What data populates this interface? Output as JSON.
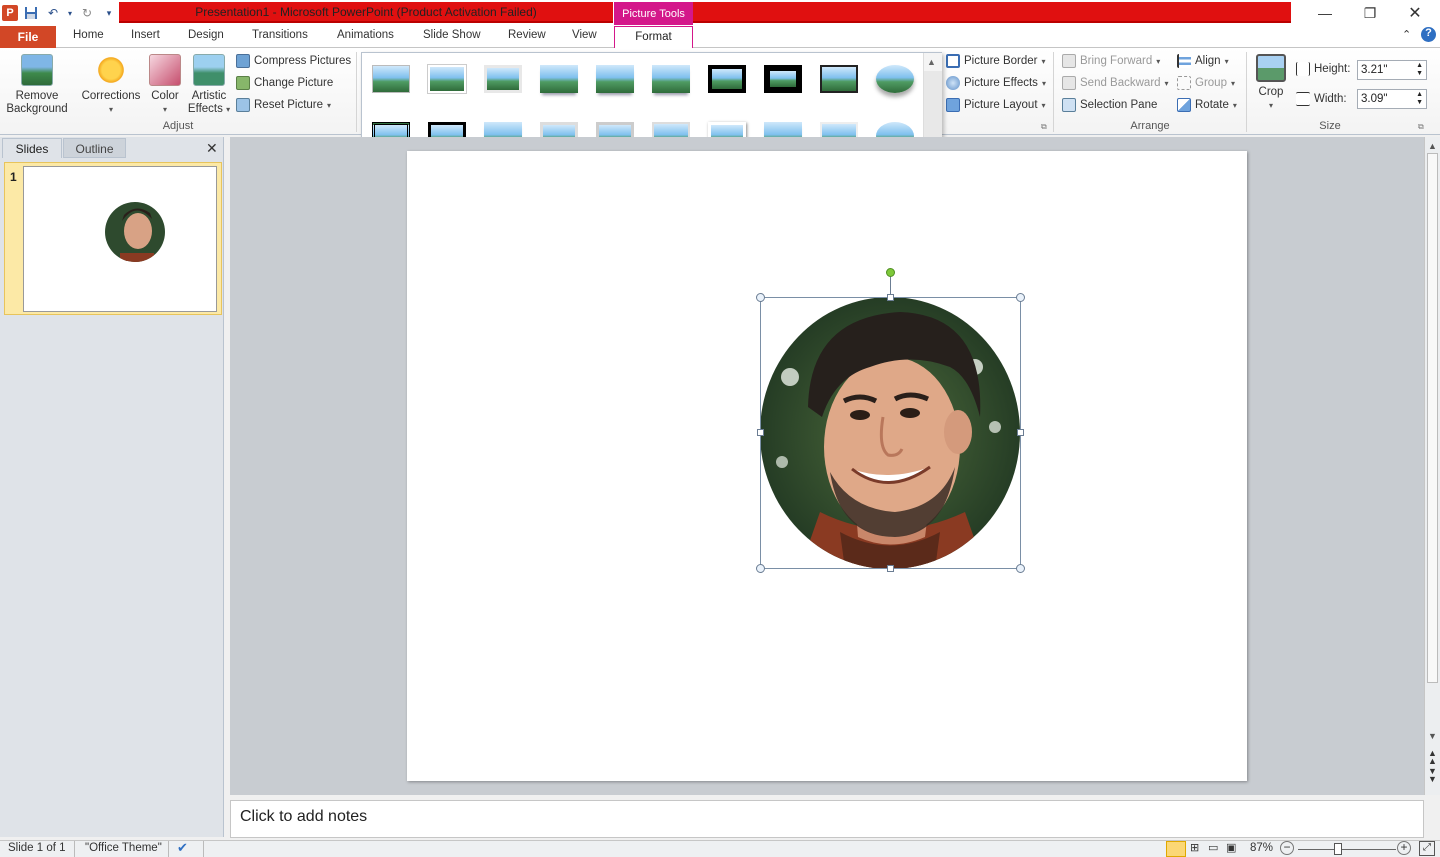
{
  "window": {
    "title": "Presentation1  -  Microsoft PowerPoint (Product Activation Failed)",
    "context_tab_group": "Picture Tools",
    "controls": [
      "minimize",
      "restore",
      "close"
    ]
  },
  "tabs": {
    "file": "File",
    "items": [
      "Home",
      "Insert",
      "Design",
      "Transitions",
      "Animations",
      "Slide Show",
      "Review",
      "View"
    ],
    "active": "Format"
  },
  "ribbon": {
    "adjust": {
      "remove_background": [
        "Remove",
        "Background"
      ],
      "corrections": "Corrections",
      "color": "Color",
      "artistic_effects": [
        "Artistic",
        "Effects"
      ],
      "compress": "Compress Pictures",
      "change": "Change Picture",
      "reset": "Reset Picture",
      "label": "Adjust"
    },
    "picture_styles": {
      "border": "Picture Border",
      "effects": "Picture Effects",
      "layout": "Picture Layout"
    },
    "arrange": {
      "bring_forward": "Bring Forward",
      "send_backward": "Send Backward",
      "selection_pane": "Selection Pane",
      "align": "Align",
      "group": "Group",
      "rotate": "Rotate",
      "label": "Arrange"
    },
    "size": {
      "crop": "Crop",
      "height_label": "Height:",
      "height_value": "3.21\"",
      "width_label": "Width:",
      "width_value": "3.09\"",
      "label": "Size"
    }
  },
  "gallery": {
    "style_count": 28
  },
  "slides_pane": {
    "slides_tab": "Slides",
    "outline_tab": "Outline",
    "slide_number": "1"
  },
  "notes": {
    "placeholder": "Click to add notes"
  },
  "status": {
    "slide": "Slide 1 of 1",
    "theme": "\"Office Theme\"",
    "zoom": "87%"
  },
  "colors": {
    "title_bar": "#e01010",
    "file_tab": "#d24726",
    "context_tab": "#d4178a",
    "rotation_handle": "#7ec83a"
  }
}
